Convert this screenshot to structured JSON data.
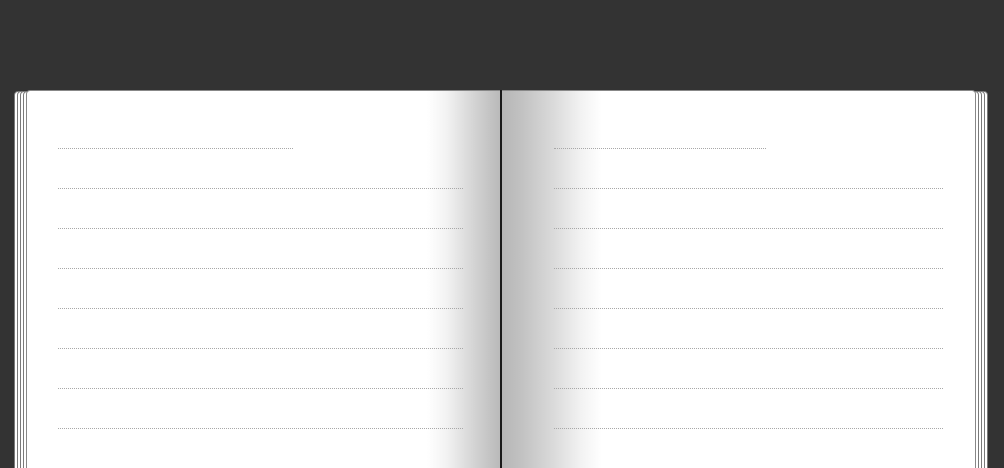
{
  "notebook": {
    "left_page": {
      "title_line": "",
      "lines": [
        "",
        "",
        "",
        "",
        "",
        "",
        ""
      ]
    },
    "right_page": {
      "title_line": "",
      "lines": [
        "",
        "",
        "",
        "",
        "",
        "",
        ""
      ]
    }
  }
}
